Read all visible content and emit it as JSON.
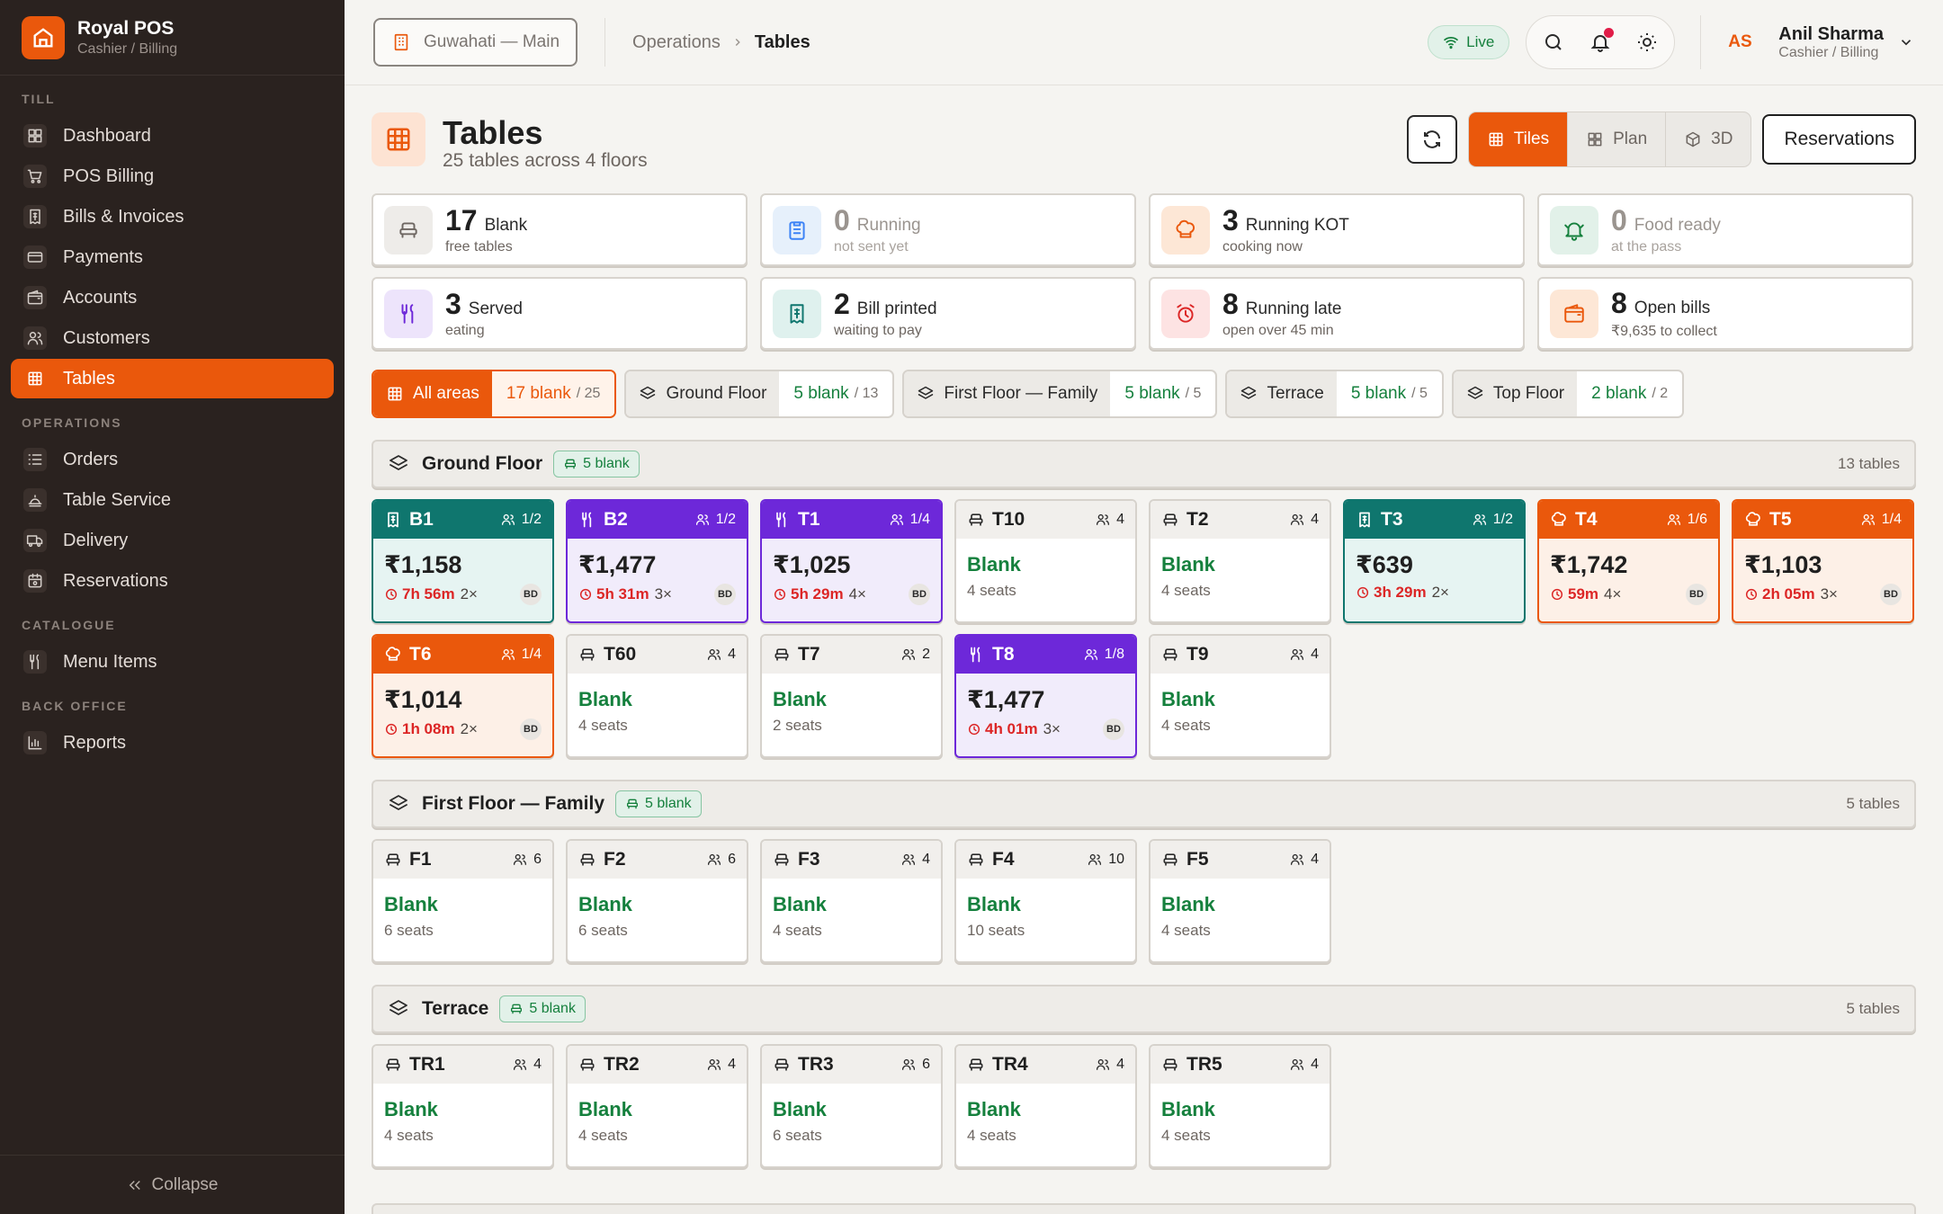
{
  "brand": {
    "name": "Royal POS",
    "role": "Cashier / Billing"
  },
  "sidebar": {
    "sections": [
      {
        "title": "TILL",
        "items": [
          {
            "label": "Dashboard",
            "icon": "dashboard-icon"
          },
          {
            "label": "POS Billing",
            "icon": "cart-icon"
          },
          {
            "label": "Bills & Invoices",
            "icon": "bill-icon"
          },
          {
            "label": "Payments",
            "icon": "card-icon"
          },
          {
            "label": "Accounts",
            "icon": "wallet-icon"
          },
          {
            "label": "Customers",
            "icon": "users-icon"
          },
          {
            "label": "Tables",
            "icon": "grid-icon",
            "active": true
          }
        ]
      },
      {
        "title": "OPERATIONS",
        "items": [
          {
            "label": "Orders",
            "icon": "list-icon"
          },
          {
            "label": "Table Service",
            "icon": "service-icon"
          },
          {
            "label": "Delivery",
            "icon": "truck-icon"
          },
          {
            "label": "Reservations",
            "icon": "calendar-icon"
          }
        ]
      },
      {
        "title": "CATALOGUE",
        "items": [
          {
            "label": "Menu Items",
            "icon": "utensils-icon"
          }
        ]
      },
      {
        "title": "BACK OFFICE",
        "items": [
          {
            "label": "Reports",
            "icon": "chart-icon"
          }
        ]
      }
    ],
    "collapse_label": "Collapse"
  },
  "topbar": {
    "branch": "Guwahati — Main",
    "breadcrumb": [
      "Operations",
      "Tables"
    ],
    "live": "Live",
    "user": {
      "initials": "AS",
      "name": "Anil Sharma",
      "role": "Cashier / Billing"
    }
  },
  "page": {
    "title": "Tables",
    "subtitle": "25 tables across 4 floors",
    "views": [
      {
        "label": "Tiles",
        "active": true
      },
      {
        "label": "Plan"
      },
      {
        "label": "3D"
      }
    ],
    "reservations_label": "Reservations"
  },
  "stats": [
    {
      "num": "17",
      "label": "Blank",
      "sub": "free tables",
      "icon": "seat-icon",
      "bg": "#eeece9",
      "fg": "#6d6661"
    },
    {
      "num": "0",
      "label": "Running",
      "sub": "not sent yet",
      "icon": "clipboard-icon",
      "bg": "#e6f0fb",
      "fg": "#3b82f6",
      "dim": true
    },
    {
      "num": "3",
      "label": "Running KOT",
      "sub": "cooking now",
      "icon": "chef-hat-icon",
      "bg": "#fde7d6",
      "fg": "#ea580c"
    },
    {
      "num": "0",
      "label": "Food ready",
      "sub": "at the pass",
      "icon": "bell-ready-icon",
      "bg": "#e2f1e9",
      "fg": "#15803d",
      "dim": true
    },
    {
      "num": "3",
      "label": "Served",
      "sub": "eating",
      "icon": "utensils-icon",
      "bg": "#ede4fb",
      "fg": "#6d28d9"
    },
    {
      "num": "2",
      "label": "Bill printed",
      "sub": "waiting to pay",
      "icon": "bill-icon",
      "bg": "#dff1ee",
      "fg": "#0f766e"
    },
    {
      "num": "8",
      "label": "Running late",
      "sub": "open over 45 min",
      "icon": "alarm-icon",
      "bg": "#fde3e3",
      "fg": "#dc2626"
    },
    {
      "num": "8",
      "label": "Open bills",
      "sub": "₹9,635 to collect",
      "icon": "wallet-icon",
      "bg": "#fde7d6",
      "fg": "#ea580c"
    }
  ],
  "filters": [
    {
      "label": "All areas",
      "count": "17 blank",
      "total": "/ 25",
      "active": true
    },
    {
      "label": "Ground Floor",
      "count": "5 blank",
      "total": "/ 13"
    },
    {
      "label": "First Floor — Family",
      "count": "5 blank",
      "total": "/ 5"
    },
    {
      "label": "Terrace",
      "count": "5 blank",
      "total": "/ 5"
    },
    {
      "label": "Top Floor",
      "count": "2 blank",
      "total": "/ 2"
    }
  ],
  "floors": [
    {
      "name": "Ground Floor",
      "badge": "5 blank",
      "count": "13 tables",
      "tables": [
        {
          "name": "B1",
          "status": "billed",
          "cap": "1/2",
          "amount": "₹1,158",
          "time": "7h 56m",
          "covers": "2×",
          "bd": "BD"
        },
        {
          "name": "B2",
          "status": "served",
          "cap": "1/2",
          "amount": "₹1,477",
          "time": "5h 31m",
          "covers": "3×",
          "bd": "BD"
        },
        {
          "name": "T1",
          "status": "served",
          "cap": "1/4",
          "amount": "₹1,025",
          "time": "5h 29m",
          "covers": "4×",
          "bd": "BD"
        },
        {
          "name": "T10",
          "status": "blank",
          "cap": "4",
          "blank": "Blank",
          "seats": "4 seats"
        },
        {
          "name": "T2",
          "status": "blank",
          "cap": "4",
          "blank": "Blank",
          "seats": "4 seats"
        },
        {
          "name": "T3",
          "status": "billed",
          "cap": "1/2",
          "amount": "₹639",
          "time": "3h 29m",
          "covers": "2×"
        },
        {
          "name": "T4",
          "status": "kot",
          "cap": "1/6",
          "amount": "₹1,742",
          "time": "59m",
          "covers": "4×",
          "bd": "BD"
        },
        {
          "name": "T5",
          "status": "kot",
          "cap": "1/4",
          "amount": "₹1,103",
          "time": "2h 05m",
          "covers": "3×",
          "bd": "BD"
        },
        {
          "name": "T6",
          "status": "kot",
          "cap": "1/4",
          "amount": "₹1,014",
          "time": "1h 08m",
          "covers": "2×",
          "bd": "BD"
        },
        {
          "name": "T60",
          "status": "blank",
          "cap": "4",
          "blank": "Blank",
          "seats": "4 seats"
        },
        {
          "name": "T7",
          "status": "blank",
          "cap": "2",
          "blank": "Blank",
          "seats": "2 seats"
        },
        {
          "name": "T8",
          "status": "served",
          "cap": "1/8",
          "amount": "₹1,477",
          "time": "4h 01m",
          "covers": "3×",
          "bd": "BD"
        },
        {
          "name": "T9",
          "status": "blank",
          "cap": "4",
          "blank": "Blank",
          "seats": "4 seats"
        }
      ]
    },
    {
      "name": "First Floor — Family",
      "badge": "5 blank",
      "count": "5 tables",
      "tables": [
        {
          "name": "F1",
          "status": "blank",
          "cap": "6",
          "blank": "Blank",
          "seats": "6 seats"
        },
        {
          "name": "F2",
          "status": "blank",
          "cap": "6",
          "blank": "Blank",
          "seats": "6 seats"
        },
        {
          "name": "F3",
          "status": "blank",
          "cap": "4",
          "blank": "Blank",
          "seats": "4 seats"
        },
        {
          "name": "F4",
          "status": "blank",
          "cap": "10",
          "blank": "Blank",
          "seats": "10 seats"
        },
        {
          "name": "F5",
          "status": "blank",
          "cap": "4",
          "blank": "Blank",
          "seats": "4 seats"
        }
      ]
    },
    {
      "name": "Terrace",
      "badge": "5 blank",
      "count": "5 tables",
      "tables": [
        {
          "name": "TR1",
          "status": "blank",
          "cap": "4",
          "blank": "Blank",
          "seats": "4 seats"
        },
        {
          "name": "TR2",
          "status": "blank",
          "cap": "4",
          "blank": "Blank",
          "seats": "4 seats"
        },
        {
          "name": "TR3",
          "status": "blank",
          "cap": "6",
          "blank": "Blank",
          "seats": "6 seats"
        },
        {
          "name": "TR4",
          "status": "blank",
          "cap": "4",
          "blank": "Blank",
          "seats": "4 seats"
        },
        {
          "name": "TR5",
          "status": "blank",
          "cap": "4",
          "blank": "Blank",
          "seats": "4 seats"
        }
      ]
    }
  ],
  "colors": {
    "accent": "#ea580c",
    "served": "#6d28d9",
    "billed": "#0f766e",
    "blank": "#15803d",
    "late": "#dc2626"
  }
}
